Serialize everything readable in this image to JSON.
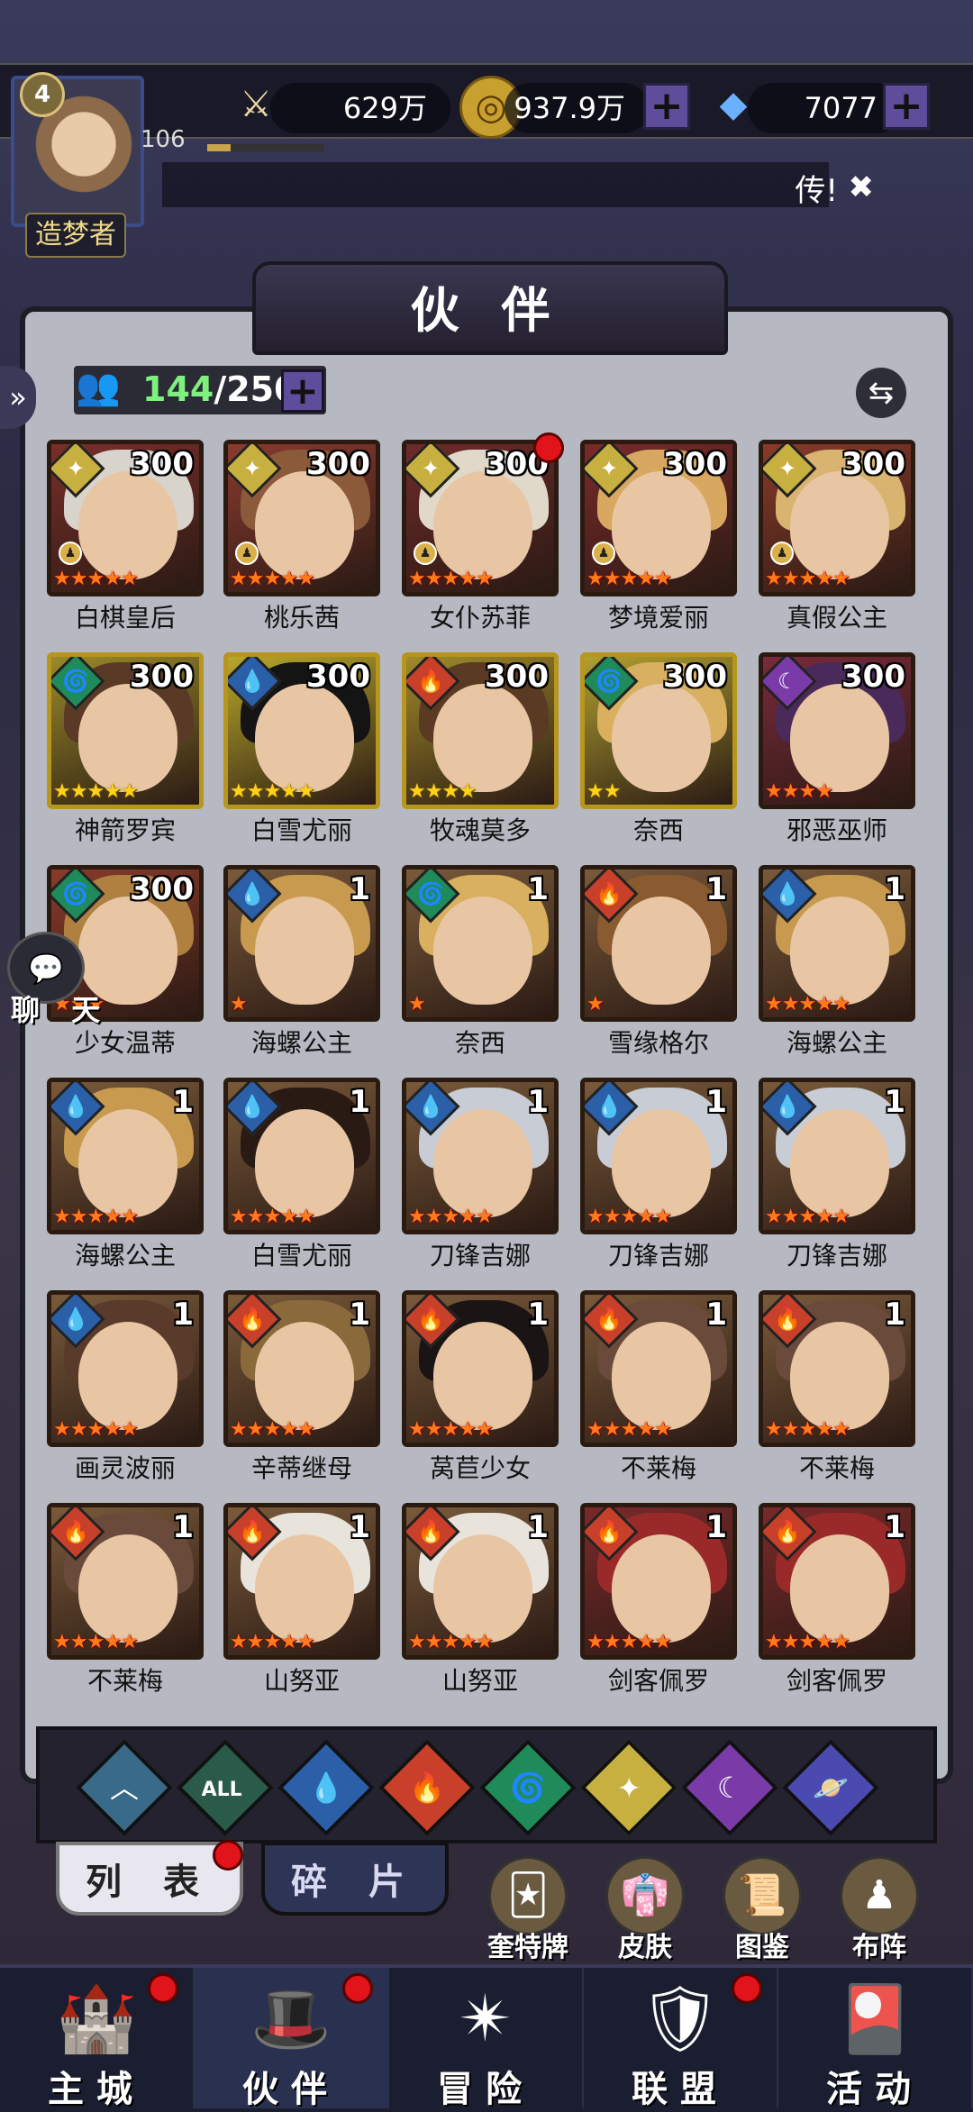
{
  "player": {
    "level_badge": "4",
    "xp_level": "106",
    "xp_progress": 0.2,
    "rank_title": "造梦者"
  },
  "resources": [
    {
      "name": "power",
      "icon": "sword-icon",
      "value": "629万"
    },
    {
      "name": "gold",
      "icon": "gold-coin-icon",
      "value": "937.9万"
    },
    {
      "name": "diamond",
      "icon": "diamond-icon",
      "value": "7077"
    }
  ],
  "ticker": {
    "text": "传!"
  },
  "page_title": "伙 伴",
  "capacity": {
    "current": "144",
    "max": "/250"
  },
  "chat_label": "聊 天",
  "colors": {
    "fire": "#c8402a",
    "water": "#2b5fa8",
    "wind": "#1f8a5a",
    "light": "#c8b040",
    "dark": "#7a3aa8",
    "orange_star": "#ff7a1a",
    "gold_star": "#ffd21a"
  },
  "partners": [
    {
      "name": "白棋皇后",
      "level": "300",
      "element": "light",
      "stars": 5,
      "star_color": "orange",
      "has_class": true,
      "frame": "brown",
      "hair": "#d8d4cc",
      "bg": "#7a2e2a",
      "alert": false
    },
    {
      "name": "桃乐茜",
      "level": "300",
      "element": "light",
      "stars": 5,
      "star_color": "orange",
      "has_class": true,
      "frame": "brown",
      "hair": "#8a5a3a",
      "bg": "#8a3a2e",
      "alert": false
    },
    {
      "name": "女仆苏菲",
      "level": "300",
      "element": "light",
      "stars": 5,
      "star_color": "orange",
      "has_class": true,
      "frame": "brown",
      "hair": "#e0d8c8",
      "bg": "#6e2a2a",
      "alert": true
    },
    {
      "name": "梦境爱丽",
      "level": "300",
      "element": "light",
      "stars": 5,
      "star_color": "orange",
      "has_class": true,
      "frame": "brown",
      "hair": "#d8a860",
      "bg": "#7a2a2a",
      "alert": false
    },
    {
      "name": "真假公主",
      "level": "300",
      "element": "light",
      "stars": 5,
      "star_color": "orange",
      "has_class": true,
      "frame": "brown",
      "hair": "#d8b470",
      "bg": "#8a3a2a",
      "alert": false
    },
    {
      "name": "神箭罗宾",
      "level": "300",
      "element": "wind",
      "stars": 5,
      "star_color": "gold",
      "has_class": false,
      "frame": "gold",
      "hair": "#5a3a26",
      "bg": "#9a8a2a",
      "alert": false
    },
    {
      "name": "白雪尤丽",
      "level": "300",
      "element": "water",
      "stars": 5,
      "star_color": "gold",
      "has_class": false,
      "frame": "gold",
      "hair": "#141414",
      "bg": "#b8a82a",
      "alert": false
    },
    {
      "name": "牧魂莫多",
      "level": "300",
      "element": "fire",
      "stars": 4,
      "star_color": "gold",
      "has_class": false,
      "frame": "gold",
      "hair": "#5a3a22",
      "bg": "#a08a2a",
      "alert": false
    },
    {
      "name": "奈西",
      "level": "300",
      "element": "wind",
      "stars": 2,
      "star_color": "gold",
      "has_class": false,
      "frame": "gold",
      "hair": "#d8b060",
      "bg": "#b0a030",
      "alert": false
    },
    {
      "name": "邪恶巫师",
      "level": "300",
      "element": "dark",
      "stars": 4,
      "star_color": "orange",
      "has_class": false,
      "frame": "brown",
      "hair": "#4a2a5a",
      "bg": "#7a2a3a",
      "alert": false
    },
    {
      "name": "少女温蒂",
      "level": "300",
      "element": "wind",
      "stars": 3,
      "star_color": "orange",
      "has_class": false,
      "frame": "brown",
      "hair": "#b08040",
      "bg": "#8a3a2a",
      "alert": false
    },
    {
      "name": "海螺公主",
      "level": "1",
      "element": "water",
      "stars": 1,
      "star_color": "orange",
      "has_class": false,
      "frame": "brown",
      "hair": "#c89a50",
      "bg": "#7a5a3a",
      "alert": false
    },
    {
      "name": "奈西",
      "level": "1",
      "element": "wind",
      "stars": 1,
      "star_color": "orange",
      "has_class": false,
      "frame": "brown",
      "hair": "#d8b060",
      "bg": "#7a5a3a",
      "alert": false
    },
    {
      "name": "雪缘格尔",
      "level": "1",
      "element": "fire",
      "stars": 1,
      "star_color": "orange",
      "has_class": false,
      "frame": "brown",
      "hair": "#8a5a30",
      "bg": "#7a5a3a",
      "alert": false
    },
    {
      "name": "海螺公主",
      "level": "1",
      "element": "water",
      "stars": 5,
      "star_color": "orange",
      "has_class": false,
      "frame": "brown",
      "hair": "#c89a50",
      "bg": "#7a5a3a",
      "alert": false
    },
    {
      "name": "海螺公主",
      "level": "1",
      "element": "water",
      "stars": 5,
      "star_color": "orange",
      "has_class": false,
      "frame": "brown",
      "hair": "#c89a50",
      "bg": "#7a5a3a",
      "alert": false
    },
    {
      "name": "白雪尤丽",
      "level": "1",
      "element": "water",
      "stars": 5,
      "star_color": "orange",
      "has_class": false,
      "frame": "brown",
      "hair": "#2a1a14",
      "bg": "#7a5a3a",
      "alert": false
    },
    {
      "name": "刀锋吉娜",
      "level": "1",
      "element": "water",
      "stars": 5,
      "star_color": "orange",
      "has_class": false,
      "frame": "brown",
      "hair": "#c8ccd4",
      "bg": "#7a5a3a",
      "alert": false
    },
    {
      "name": "刀锋吉娜",
      "level": "1",
      "element": "water",
      "stars": 5,
      "star_color": "orange",
      "has_class": false,
      "frame": "brown",
      "hair": "#c8ccd4",
      "bg": "#7a5a3a",
      "alert": false
    },
    {
      "name": "刀锋吉娜",
      "level": "1",
      "element": "water",
      "stars": 5,
      "star_color": "orange",
      "has_class": false,
      "frame": "brown",
      "hair": "#c8ccd4",
      "bg": "#7a5a3a",
      "alert": false
    },
    {
      "name": "画灵波丽",
      "level": "1",
      "element": "water",
      "stars": 5,
      "star_color": "orange",
      "has_class": false,
      "frame": "brown",
      "hair": "#5a3a2a",
      "bg": "#7a5a3a",
      "alert": false
    },
    {
      "name": "辛蒂继母",
      "level": "1",
      "element": "fire",
      "stars": 5,
      "star_color": "orange",
      "has_class": false,
      "frame": "brown",
      "hair": "#8a6a3a",
      "bg": "#7a5a3a",
      "alert": false
    },
    {
      "name": "莴苣少女",
      "level": "1",
      "element": "fire",
      "stars": 5,
      "star_color": "orange",
      "has_class": false,
      "frame": "brown",
      "hair": "#1a1414",
      "bg": "#7a5a3a",
      "alert": false
    },
    {
      "name": "不莱梅",
      "level": "1",
      "element": "fire",
      "stars": 5,
      "star_color": "orange",
      "has_class": false,
      "frame": "brown",
      "hair": "#6a4a3a",
      "bg": "#7a5a3a",
      "alert": false
    },
    {
      "name": "不莱梅",
      "level": "1",
      "element": "fire",
      "stars": 5,
      "star_color": "orange",
      "has_class": false,
      "frame": "brown",
      "hair": "#6a4a3a",
      "bg": "#7a5a3a",
      "alert": false
    },
    {
      "name": "不莱梅",
      "level": "1",
      "element": "fire",
      "stars": 5,
      "star_color": "orange",
      "has_class": false,
      "frame": "brown",
      "hair": "#6a4a3a",
      "bg": "#7a5a3a",
      "alert": false
    },
    {
      "name": "山努亚",
      "level": "1",
      "element": "fire",
      "stars": 5,
      "star_color": "orange",
      "has_class": false,
      "frame": "brown",
      "hair": "#e8e4dc",
      "bg": "#7a5a3a",
      "alert": false
    },
    {
      "name": "山努亚",
      "level": "1",
      "element": "fire",
      "stars": 5,
      "star_color": "orange",
      "has_class": false,
      "frame": "brown",
      "hair": "#e8e4dc",
      "bg": "#7a5a3a",
      "alert": false
    },
    {
      "name": "剑客佩罗",
      "level": "1",
      "element": "fire",
      "stars": 5,
      "star_color": "orange",
      "has_class": false,
      "frame": "brown",
      "hair": "#9a2a2a",
      "bg": "#7a2a2a",
      "alert": false
    },
    {
      "name": "剑客佩罗",
      "level": "1",
      "element": "fire",
      "stars": 5,
      "star_color": "orange",
      "has_class": false,
      "frame": "brown",
      "hair": "#9a2a2a",
      "bg": "#7a2a2a",
      "alert": false
    }
  ],
  "filters": [
    {
      "name": "filter-back",
      "icon": "chevron-up-icon",
      "glyph": "︿",
      "bg": "#3a6a8a"
    },
    {
      "name": "filter-all",
      "icon": "all-icon",
      "glyph": "ALL",
      "bg": "#2a5a4a"
    },
    {
      "name": "filter-water",
      "icon": "water-drop-icon",
      "glyph": "💧",
      "bg": "#2b5fa8"
    },
    {
      "name": "filter-fire",
      "icon": "flame-icon",
      "glyph": "🔥",
      "bg": "#c8402a"
    },
    {
      "name": "filter-wind",
      "icon": "whirlwind-icon",
      "glyph": "🌀",
      "bg": "#1f8a5a"
    },
    {
      "name": "filter-light",
      "icon": "star-icon",
      "glyph": "✦",
      "bg": "#c8b040"
    },
    {
      "name": "filter-dark",
      "icon": "moon-icon",
      "glyph": "☾",
      "bg": "#7a3aa8"
    },
    {
      "name": "filter-planet",
      "icon": "planet-icon",
      "glyph": "🪐",
      "bg": "#4a4ab0"
    }
  ],
  "tabs": {
    "list": "列 表",
    "fragments": "碎 片"
  },
  "sub_buttons": [
    {
      "name": "tarot-button",
      "label": "奎特牌",
      "icon": "tarot-card-icon",
      "glyph": "🃏"
    },
    {
      "name": "skin-button",
      "label": "皮肤",
      "icon": "clothing-icon",
      "glyph": "👘"
    },
    {
      "name": "codex-button",
      "label": "图鉴",
      "icon": "portrait-book-icon",
      "glyph": "📜"
    },
    {
      "name": "formation-button",
      "label": "布阵",
      "icon": "chess-icon",
      "glyph": "♟"
    }
  ],
  "nav": [
    {
      "name": "nav-main-city",
      "label": "主城",
      "icon": "castle-icon",
      "glyph": "🏰",
      "alert": true,
      "active": false
    },
    {
      "name": "nav-partners",
      "label": "伙伴",
      "icon": "witch-hat-icon",
      "glyph": "🎩",
      "alert": true,
      "active": true
    },
    {
      "name": "nav-adventure",
      "label": "冒险",
      "icon": "compass-star-icon",
      "glyph": "✴",
      "alert": false,
      "active": false
    },
    {
      "name": "nav-alliance",
      "label": "联盟",
      "icon": "shield-icon",
      "glyph": "🛡",
      "alert": true,
      "active": false
    },
    {
      "name": "nav-events",
      "label": "活动",
      "icon": "cards-icon",
      "glyph": "🎴",
      "alert": false,
      "active": false
    }
  ]
}
